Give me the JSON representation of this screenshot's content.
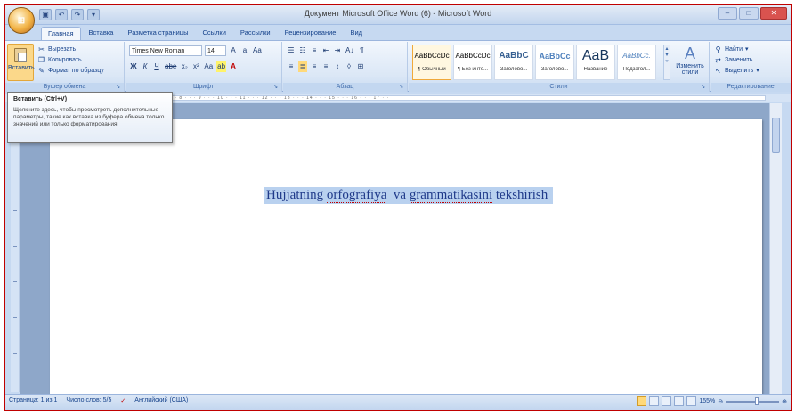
{
  "window": {
    "title": "Документ Microsoft Office Word (6) - Microsoft Word",
    "office_button_label": "",
    "controls": [
      "–",
      "□",
      "✕"
    ]
  },
  "quick_access": [
    "save-icon",
    "undo-icon",
    "redo-icon",
    "customize-icon"
  ],
  "tabs": [
    {
      "label": "Главная",
      "active": true
    },
    {
      "label": "Вставка"
    },
    {
      "label": "Разметка страницы"
    },
    {
      "label": "Ссылки"
    },
    {
      "label": "Рассылки"
    },
    {
      "label": "Рецензирование"
    },
    {
      "label": "Вид"
    }
  ],
  "ribbon": {
    "clipboard": {
      "label": "Буфер обмена",
      "paste": "Вставить",
      "cut": "Вырезать",
      "copy": "Копировать",
      "format_painter": "Формат по образцу"
    },
    "font": {
      "label": "Шрифт",
      "font_name": "Times New Roman",
      "font_size": "14",
      "row1": [
        "A",
        "a",
        "Aa"
      ],
      "row2": [
        "Ж",
        "К",
        "Ч",
        "abe",
        "x₂",
        "x²",
        "Aa",
        "ab",
        "A"
      ]
    },
    "paragraph": {
      "label": "Абзац",
      "row1": [
        "☰",
        "☷",
        "≡",
        "⇤",
        "⇥",
        "A↓",
        "¶"
      ],
      "row2": [
        "≡",
        "≣",
        "≡",
        "≡",
        "↕",
        "◊",
        "⊞"
      ]
    },
    "styles": {
      "label": "Стили",
      "items": [
        {
          "sample": "AaBbCcDc",
          "name": "¶ Обычный",
          "selected": true
        },
        {
          "sample": "AaBbCcDc",
          "name": "¶ Без инте..."
        },
        {
          "sample": "AaBbC",
          "name": "Заголово..."
        },
        {
          "sample": "AaBbCc",
          "name": "Заголово..."
        },
        {
          "sample": "AaB",
          "name": "Название"
        },
        {
          "sample": "AaBbCc.",
          "name": "Подзагол..."
        }
      ],
      "change_styles": "Изменить стили"
    },
    "editing": {
      "label": "Редактирование",
      "find": "Найти",
      "replace": "Заменить",
      "select": "Выделить"
    }
  },
  "tooltip": {
    "title": "Вставить (Ctrl+V)",
    "body": "Щелкните здесь, чтобы просмотреть дополнительные параметры, такие как вставка из буфера обмена только значений или только форматирования."
  },
  "ruler": "· 1 · · · 2 · · · 3 · · · 4 · · · 5 · · · 6 · · · 7 · · · 8 · · · 9 · · · 10 · · · 11 · · · 12 · · · 13 · · · 14 · · · 15 · · · 16 · · · 17 · ·",
  "document": {
    "text_words": [
      "Hujjatning",
      "orfografiya",
      "va",
      "grammatikasini",
      "tekshirish"
    ]
  },
  "status": {
    "page": "Страница: 1 из 1",
    "words": "Число слов: 5/5",
    "language": "Английский (США)",
    "zoom": "155%",
    "zoom_fraction": 0.58
  },
  "colors": {
    "accent": "#c00000",
    "ribbon": "#dbe7f6",
    "selection": "#b9d1ef"
  }
}
